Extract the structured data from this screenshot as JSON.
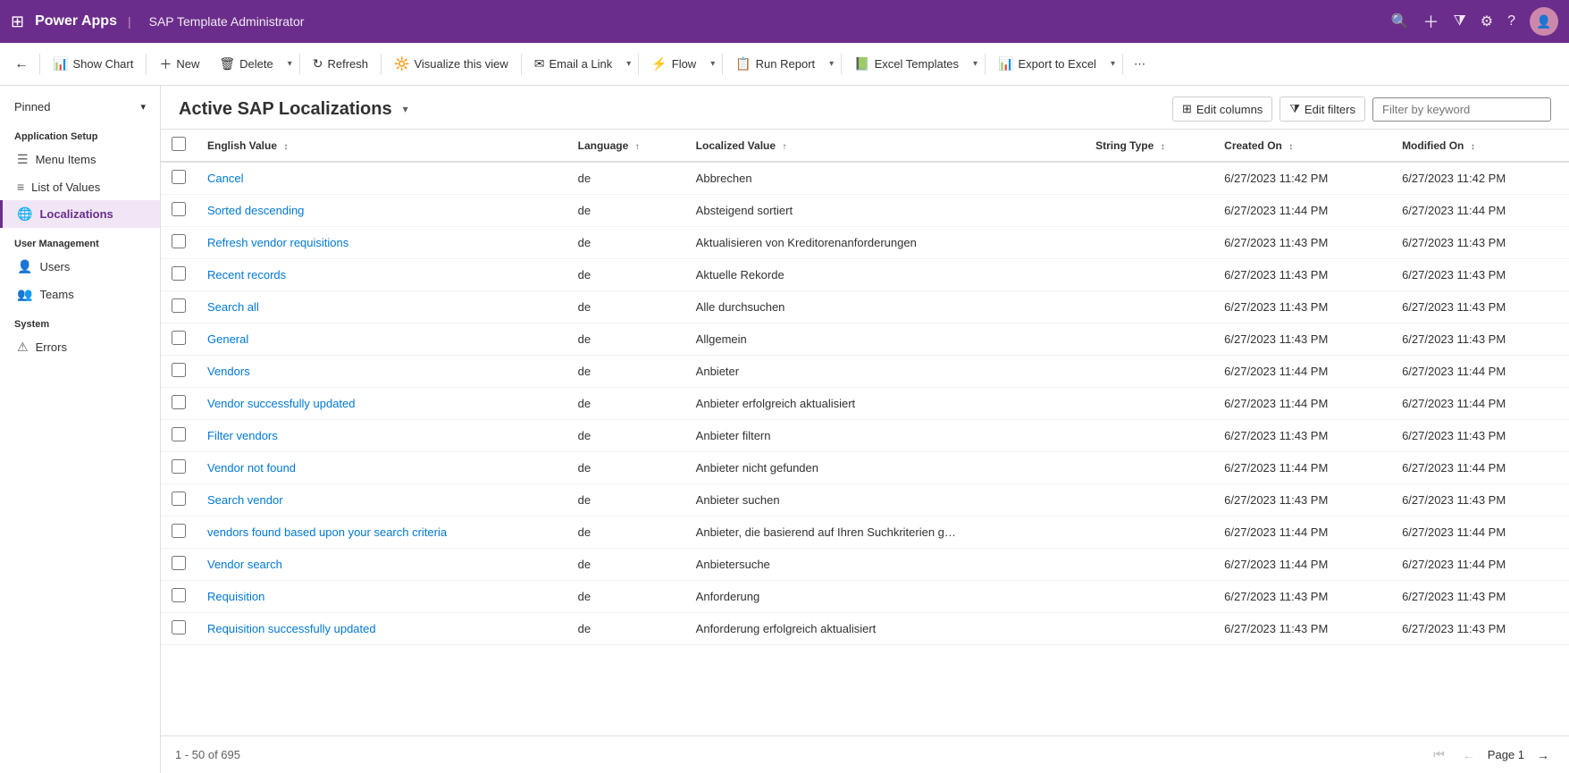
{
  "topNav": {
    "appName": "Power Apps",
    "pageTitle": "SAP Template Administrator"
  },
  "toolbar": {
    "backLabel": "←",
    "showChartLabel": "Show Chart",
    "newLabel": "New",
    "deleteLabel": "Delete",
    "refreshLabel": "Refresh",
    "visualizeLabel": "Visualize this view",
    "emailLabel": "Email a Link",
    "flowLabel": "Flow",
    "runReportLabel": "Run Report",
    "excelTemplatesLabel": "Excel Templates",
    "exportToExcelLabel": "Export to Excel"
  },
  "sidebar": {
    "pinnedLabel": "Pinned",
    "appSetupLabel": "Application Setup",
    "menuItemsLabel": "Menu Items",
    "listOfValuesLabel": "List of Values",
    "localizationsLabel": "Localizations",
    "userMgmtLabel": "User Management",
    "usersLabel": "Users",
    "teamsLabel": "Teams",
    "systemLabel": "System",
    "errorsLabel": "Errors"
  },
  "view": {
    "title": "Active SAP Localizations",
    "editColumnsLabel": "Edit columns",
    "editFiltersLabel": "Edit filters",
    "filterPlaceholder": "Filter by keyword"
  },
  "table": {
    "columns": [
      {
        "key": "englishValue",
        "label": "English Value",
        "sortable": true,
        "sortDir": "asc"
      },
      {
        "key": "language",
        "label": "Language",
        "sortable": true,
        "sortDir": "asc"
      },
      {
        "key": "localizedValue",
        "label": "Localized Value",
        "sortable": true,
        "sortDir": "asc"
      },
      {
        "key": "stringType",
        "label": "String Type",
        "sortable": true
      },
      {
        "key": "createdOn",
        "label": "Created On",
        "sortable": true
      },
      {
        "key": "modifiedOn",
        "label": "Modified On",
        "sortable": true
      }
    ],
    "rows": [
      {
        "englishValue": "Cancel",
        "language": "de",
        "localizedValue": "Abbrechen",
        "stringType": "",
        "createdOn": "6/27/2023 11:42 PM",
        "modifiedOn": "6/27/2023 11:42 PM"
      },
      {
        "englishValue": "Sorted descending",
        "language": "de",
        "localizedValue": "Absteigend sortiert",
        "stringType": "",
        "createdOn": "6/27/2023 11:44 PM",
        "modifiedOn": "6/27/2023 11:44 PM"
      },
      {
        "englishValue": "Refresh vendor requisitions",
        "language": "de",
        "localizedValue": "Aktualisieren von Kreditorenanforderungen",
        "stringType": "",
        "createdOn": "6/27/2023 11:43 PM",
        "modifiedOn": "6/27/2023 11:43 PM"
      },
      {
        "englishValue": "Recent records",
        "language": "de",
        "localizedValue": "Aktuelle Rekorde",
        "stringType": "",
        "createdOn": "6/27/2023 11:43 PM",
        "modifiedOn": "6/27/2023 11:43 PM"
      },
      {
        "englishValue": "Search all",
        "language": "de",
        "localizedValue": "Alle durchsuchen",
        "stringType": "",
        "createdOn": "6/27/2023 11:43 PM",
        "modifiedOn": "6/27/2023 11:43 PM"
      },
      {
        "englishValue": "General",
        "language": "de",
        "localizedValue": "Allgemein",
        "stringType": "",
        "createdOn": "6/27/2023 11:43 PM",
        "modifiedOn": "6/27/2023 11:43 PM"
      },
      {
        "englishValue": "Vendors",
        "language": "de",
        "localizedValue": "Anbieter",
        "stringType": "",
        "createdOn": "6/27/2023 11:44 PM",
        "modifiedOn": "6/27/2023 11:44 PM"
      },
      {
        "englishValue": "Vendor successfully updated",
        "language": "de",
        "localizedValue": "Anbieter erfolgreich aktualisiert",
        "stringType": "",
        "createdOn": "6/27/2023 11:44 PM",
        "modifiedOn": "6/27/2023 11:44 PM"
      },
      {
        "englishValue": "Filter vendors",
        "language": "de",
        "localizedValue": "Anbieter filtern",
        "stringType": "",
        "createdOn": "6/27/2023 11:43 PM",
        "modifiedOn": "6/27/2023 11:43 PM"
      },
      {
        "englishValue": "Vendor not found",
        "language": "de",
        "localizedValue": "Anbieter nicht gefunden",
        "stringType": "",
        "createdOn": "6/27/2023 11:44 PM",
        "modifiedOn": "6/27/2023 11:44 PM"
      },
      {
        "englishValue": "Search vendor",
        "language": "de",
        "localizedValue": "Anbieter suchen",
        "stringType": "",
        "createdOn": "6/27/2023 11:43 PM",
        "modifiedOn": "6/27/2023 11:43 PM"
      },
      {
        "englishValue": "vendors found based upon your search criteria",
        "language": "de",
        "localizedValue": "Anbieter, die basierend auf Ihren Suchkriterien g…",
        "stringType": "",
        "createdOn": "6/27/2023 11:44 PM",
        "modifiedOn": "6/27/2023 11:44 PM"
      },
      {
        "englishValue": "Vendor search",
        "language": "de",
        "localizedValue": "Anbietersuche",
        "stringType": "",
        "createdOn": "6/27/2023 11:44 PM",
        "modifiedOn": "6/27/2023 11:44 PM"
      },
      {
        "englishValue": "Requisition",
        "language": "de",
        "localizedValue": "Anforderung",
        "stringType": "",
        "createdOn": "6/27/2023 11:43 PM",
        "modifiedOn": "6/27/2023 11:43 PM"
      },
      {
        "englishValue": "Requisition successfully updated",
        "language": "de",
        "localizedValue": "Anforderung erfolgreich aktualisiert",
        "stringType": "",
        "createdOn": "6/27/2023 11:43 PM",
        "modifiedOn": "6/27/2023 11:43 PM"
      }
    ]
  },
  "footer": {
    "recordInfo": "1 - 50 of 695",
    "pageLabel": "Page 1"
  }
}
